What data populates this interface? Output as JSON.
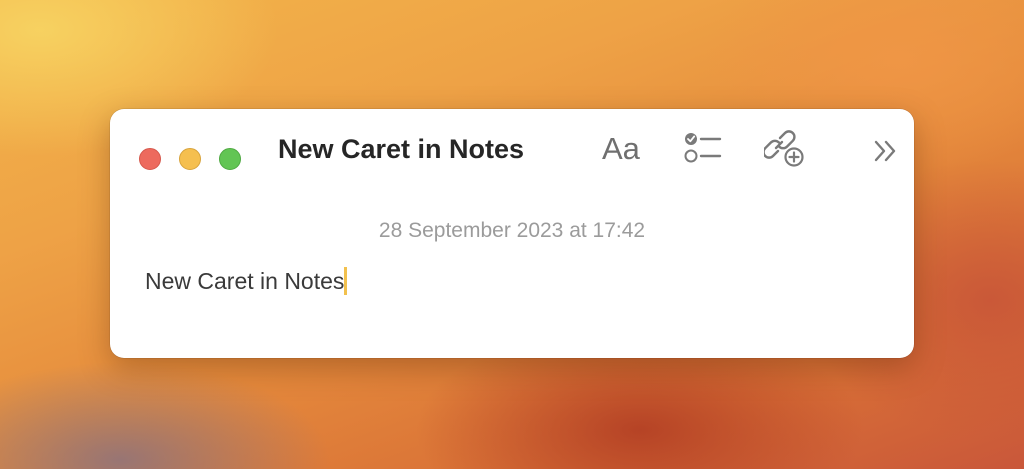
{
  "window": {
    "title": "New Caret in Notes"
  },
  "toolbar": {
    "format_label": "Aa",
    "format_icon": "text-format-icon",
    "checklist_icon": "checklist-icon",
    "collaborate_icon": "link-add-icon",
    "more_icon": "chevron-double-right-icon"
  },
  "traffic_lights": {
    "close_color": "#ed6a5e",
    "minimize_color": "#f5bf4f",
    "zoom_color": "#62c554"
  },
  "note": {
    "date": "28 September 2023 at 17:42",
    "text": "New Caret in Notes",
    "caret_color": "#f2c14e"
  }
}
